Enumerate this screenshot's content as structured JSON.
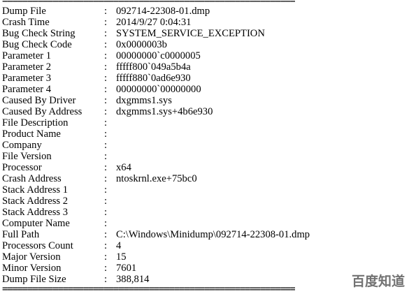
{
  "separator_top": "==========================================================",
  "separator_bottom": "==========================================================",
  "rows": [
    {
      "key": "Dump File",
      "sep": ":",
      "value": "092714-22308-01.dmp"
    },
    {
      "key": "Crash Time",
      "sep": ":",
      "value": "2014/9/27 0:04:31"
    },
    {
      "key": "Bug Check String",
      "sep": ":",
      "value": "SYSTEM_SERVICE_EXCEPTION"
    },
    {
      "key": "Bug Check Code",
      "sep": ":",
      "value": "0x0000003b"
    },
    {
      "key": "Parameter 1",
      "sep": ":",
      "value": "00000000`c0000005"
    },
    {
      "key": "Parameter 2",
      "sep": ":",
      "value": "fffff800`049a5b4a"
    },
    {
      "key": "Parameter 3",
      "sep": ":",
      "value": "fffff880`0ad6e930"
    },
    {
      "key": "Parameter 4",
      "sep": ":",
      "value": "00000000`00000000"
    },
    {
      "key": "Caused By Driver",
      "sep": ":",
      "value": "dxgmms1.sys"
    },
    {
      "key": "Caused By Address",
      "sep": ":",
      "value": "dxgmms1.sys+4b6e930"
    },
    {
      "key": "File Description",
      "sep": ":",
      "value": ""
    },
    {
      "key": "Product Name",
      "sep": ":",
      "value": ""
    },
    {
      "key": "Company",
      "sep": ":",
      "value": ""
    },
    {
      "key": "File Version",
      "sep": ":",
      "value": ""
    },
    {
      "key": "Processor",
      "sep": ":",
      "value": "x64"
    },
    {
      "key": "Crash Address",
      "sep": ":",
      "value": "ntoskrnl.exe+75bc0"
    },
    {
      "key": "Stack Address 1",
      "sep": ":",
      "value": ""
    },
    {
      "key": "Stack Address 2",
      "sep": ":",
      "value": ""
    },
    {
      "key": "Stack Address 3",
      "sep": ":",
      "value": ""
    },
    {
      "key": "Computer Name",
      "sep": ":",
      "value": ""
    },
    {
      "key": "Full Path",
      "sep": ":",
      "value": "C:\\Windows\\Minidump\\092714-22308-01.dmp"
    },
    {
      "key": "Processors Count",
      "sep": ":",
      "value": "4"
    },
    {
      "key": "Major Version",
      "sep": ":",
      "value": "15"
    },
    {
      "key": "Minor Version",
      "sep": ":",
      "value": "7601"
    },
    {
      "key": "Dump File Size",
      "sep": ":",
      "value": "388,814"
    }
  ],
  "watermark": "百度知道"
}
